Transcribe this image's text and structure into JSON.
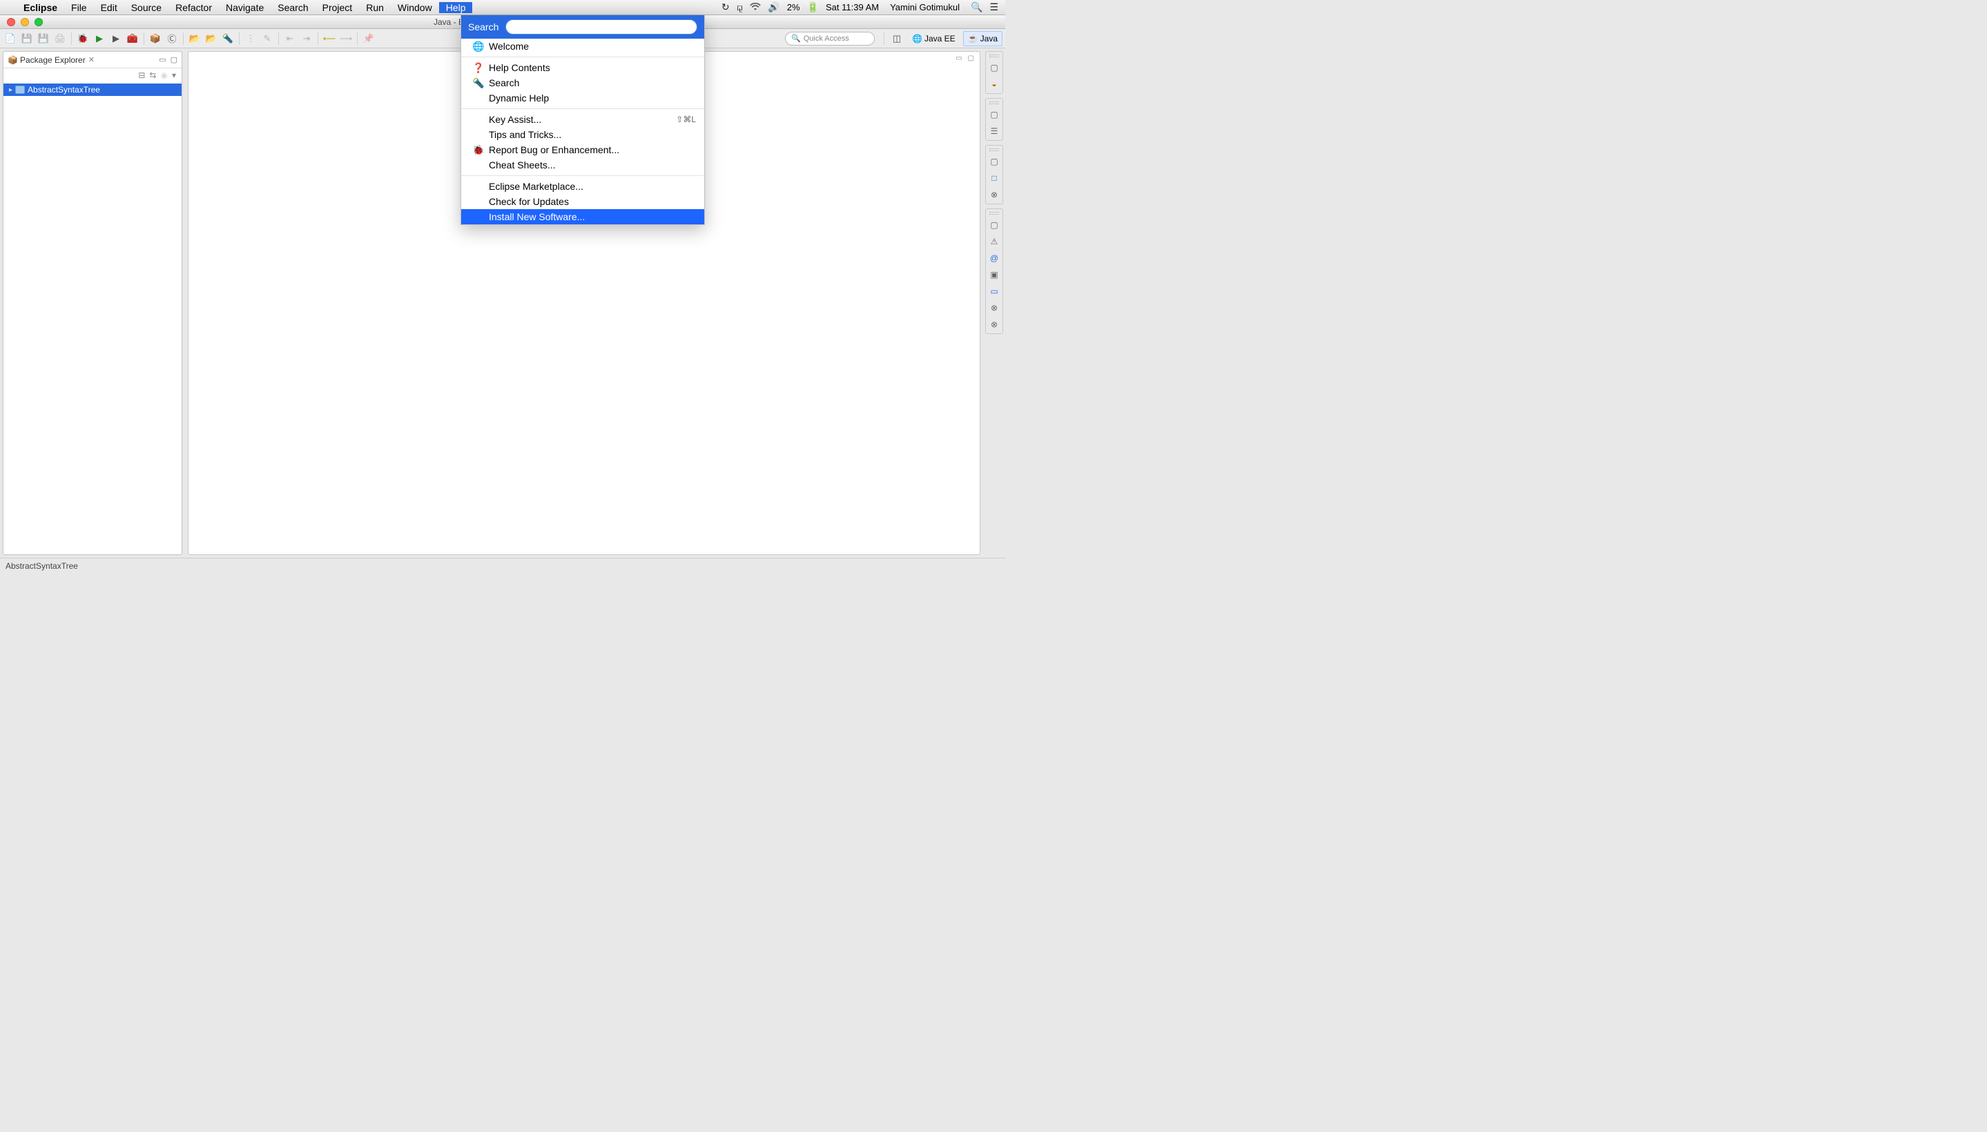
{
  "menubar": {
    "app": "Eclipse",
    "items": [
      "File",
      "Edit",
      "Source",
      "Refactor",
      "Navigate",
      "Search",
      "Project",
      "Run",
      "Window",
      "Help"
    ],
    "active": "Help"
  },
  "system_status": {
    "battery": "2%",
    "clock": "Sat 11:39 AM",
    "user": "Yamini Gotimukul"
  },
  "window": {
    "title": "Java - Eclipse - /Users/yaminigotimuk"
  },
  "quick_access": {
    "placeholder": "Quick Access"
  },
  "perspectives": {
    "javaee": "Java EE",
    "java": "Java"
  },
  "package_explorer": {
    "title": "Package Explorer",
    "project": "AbstractSyntaxTree"
  },
  "help_menu": {
    "search_label": "Search",
    "search_value": "",
    "welcome": "Welcome",
    "help_contents": "Help Contents",
    "search_item": "Search",
    "dynamic_help": "Dynamic Help",
    "key_assist": "Key Assist...",
    "key_assist_shortcut": "⇧⌘L",
    "tips": "Tips and Tricks...",
    "report_bug": "Report Bug or Enhancement...",
    "cheat_sheets": "Cheat Sheets...",
    "marketplace": "Eclipse Marketplace...",
    "check_updates": "Check for Updates",
    "install_new": "Install New Software..."
  },
  "statusbar": {
    "text": "AbstractSyntaxTree"
  }
}
